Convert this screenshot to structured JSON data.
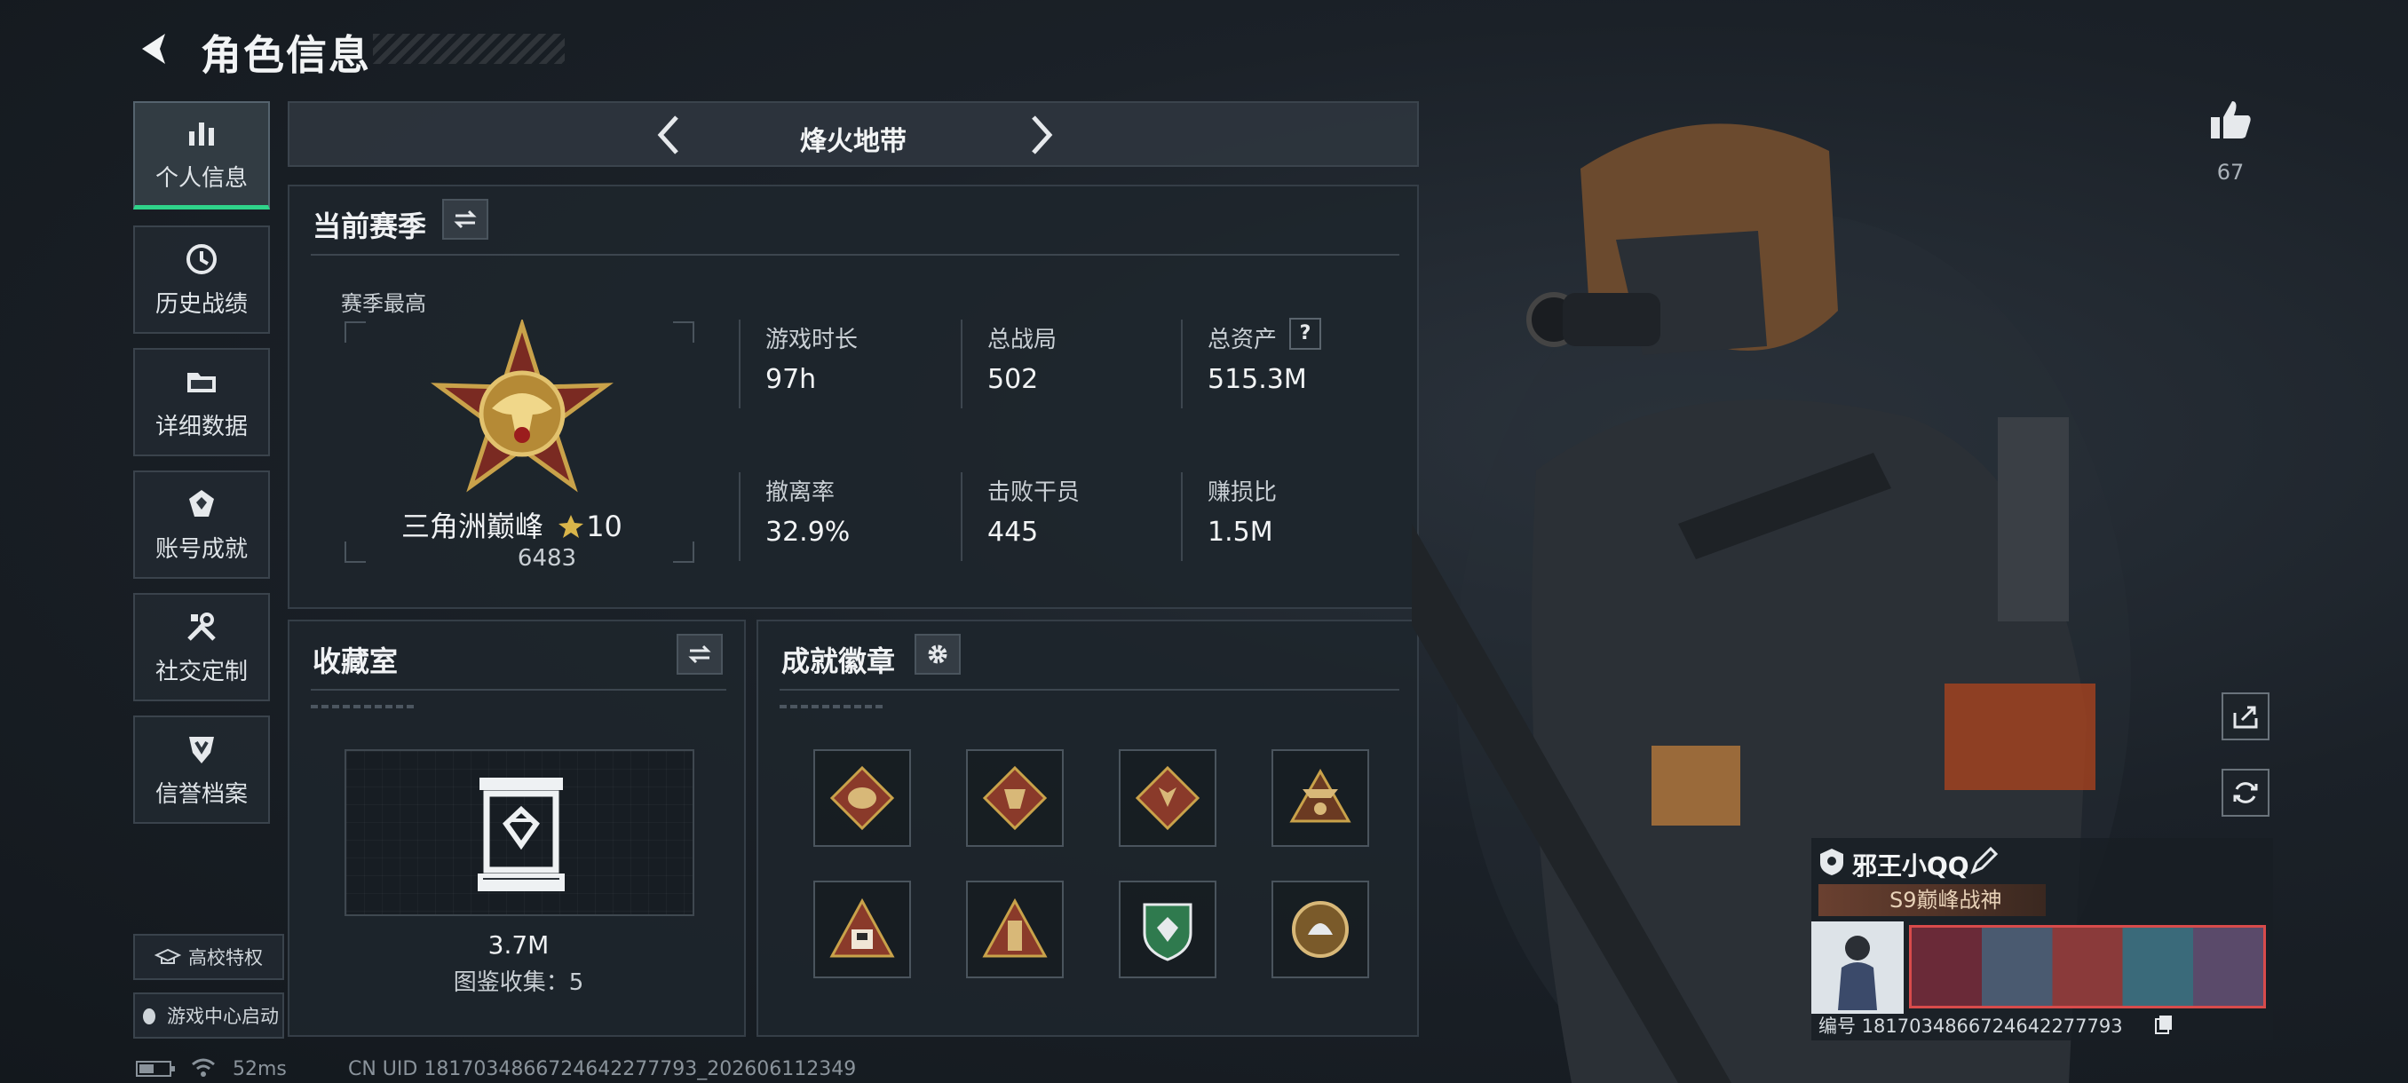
{
  "header": {
    "title": "角色信息"
  },
  "sidebar": {
    "items": [
      {
        "label": "个人信息",
        "icon": "bar-chart-icon"
      },
      {
        "label": "历史战绩",
        "icon": "history-clock-icon"
      },
      {
        "label": "详细数据",
        "icon": "folder-icon"
      },
      {
        "label": "账号成就",
        "icon": "achievement-icon"
      },
      {
        "label": "社交定制",
        "icon": "tools-icon"
      },
      {
        "label": "信誉档案",
        "icon": "shield-icon"
      }
    ],
    "campus_label": "高校特权",
    "game_center_label": "游戏中心启动"
  },
  "mode": {
    "title": "烽火地带"
  },
  "season": {
    "title": "当前赛季",
    "best_label": "赛季最高",
    "rank_name": "三角洲巅峰",
    "rank_stars": "10",
    "rank_score": "6483",
    "stats": [
      {
        "label": "游戏时长",
        "value": "97h"
      },
      {
        "label": "总战局",
        "value": "502"
      },
      {
        "label": "总资产",
        "value": "515.3M"
      },
      {
        "label": "撤离率",
        "value": "32.9%"
      },
      {
        "label": "击败干员",
        "value": "445"
      },
      {
        "label": "赚损比",
        "value": "1.5M"
      }
    ],
    "help_glyph": "?"
  },
  "collection": {
    "title": "收藏室",
    "value": "3.7M",
    "count_text": "图鉴收集：5"
  },
  "badges": {
    "title": "成就徽章",
    "items": [
      "badge-1",
      "badge-2",
      "badge-3",
      "badge-4",
      "badge-5",
      "badge-6",
      "badge-7",
      "badge-8"
    ]
  },
  "profile": {
    "likes": "67",
    "player_name": "邪王小QQ",
    "title_tag": "S9巅峰战神",
    "id_text": "编号 1817034866724642277793"
  },
  "footer": {
    "ping": "52ms",
    "uid_text": "CN UID 1817034866724642277793_202606112349"
  },
  "colors": {
    "accent_green": "#2fd38a",
    "gold": "#c9a24a",
    "badge_red": "#8a3a2a"
  }
}
